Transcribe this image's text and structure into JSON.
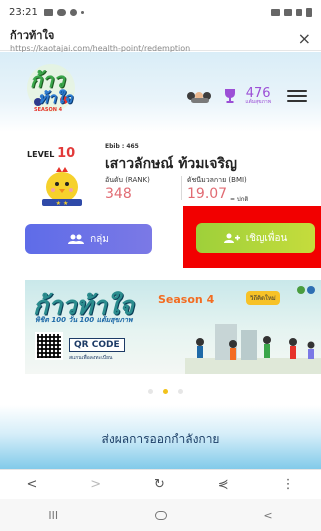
{
  "status_bar": {
    "time": "23:21"
  },
  "browser": {
    "title": "ก้าวท้าใจ",
    "url": "https://kaotajai.com/health-point/redemption",
    "close_glyph": "×"
  },
  "header": {
    "logo_line1": "ก้าว",
    "logo_line2": "ท้าใจ",
    "logo_season": "SEASON 4",
    "points": "476",
    "points_label": "แต้มสุขภาพ"
  },
  "profile": {
    "level_label": "LEVEL",
    "level_value": "10",
    "ebib": "Ebib : 465",
    "name": "เสาวลักษณ์ ท้วมเจริญ",
    "rank_label": "อันดับ (RANK)",
    "rank_value": "348",
    "bmi_label": "ดัชนีมวลกาย (BMI)",
    "bmi_value": "19.07",
    "bmi_unit": "= ปกติ"
  },
  "buttons": {
    "group_label": "กลุ่ม",
    "invite_label": "เชิญเพื่อน"
  },
  "banner": {
    "title": "ก้าวท้าใจ",
    "season": "Season 4",
    "pill": "วิถีคิดใหม่",
    "subtitle": "พิชิต 100 วัน 100 แต้มสุขภาพ",
    "qr_label": "QR CODE",
    "qr_sub": "สแกนเพื่อลงทะเบียน"
  },
  "submit": {
    "label": "ส่งผลการออกกำลังกาย"
  },
  "browser_nav": {
    "back": "<",
    "forward": ">",
    "reload": "↻",
    "share": "⋞",
    "more": "⋮"
  },
  "sys_nav": {
    "recents": "III",
    "back": "<"
  },
  "colors": {
    "accent_purple": "#6b6fe6",
    "accent_green": "#a8d23a",
    "highlight_red": "#f20000"
  }
}
